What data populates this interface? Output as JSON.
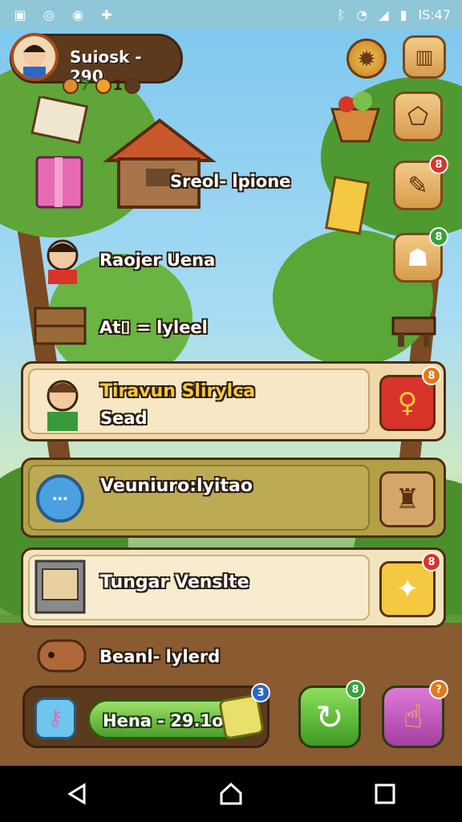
{
  "status_bar": {
    "time": "IS:47",
    "left_icons": [
      "app-icon",
      "circle-icon",
      "globe-icon",
      "puzzle-icon"
    ],
    "right_icons": [
      "bluetooth-icon",
      "wifi-icon",
      "signal-icon",
      "battery-icon"
    ]
  },
  "profile": {
    "name": "Suiosk - 290",
    "currency": [
      {
        "icon": "leaf-icon",
        "value": "7",
        "color": "#e38b2c"
      },
      {
        "icon": "coin-icon",
        "value": "1",
        "color": "#f0a22a"
      }
    ]
  },
  "top_buttons": {
    "settings": "gear-icon",
    "inventory": "box-icon"
  },
  "map_labels": {
    "house": "Sreol- lpione",
    "person": "Raojer Uena",
    "crate": "At⌷ = lyleel"
  },
  "side_buttons": [
    {
      "icon": "map-icon",
      "badge": ""
    },
    {
      "icon": "tool-icon",
      "badge": "8"
    },
    {
      "icon": "ghost-icon",
      "badge": "8"
    }
  ],
  "cards": [
    {
      "title": "Tiravun Slirylca",
      "sub": "Sead",
      "button_icon": "key-icon",
      "badge": "8",
      "theme": "cream"
    },
    {
      "title": "Veuniuro:lyitao",
      "sub": "",
      "button_icon": "stamp-icon",
      "badge": "",
      "theme": "olive"
    },
    {
      "title": "Tungar Venslte",
      "sub": "",
      "button_icon": "star-icon",
      "badge": "8",
      "theme": "light"
    }
  ],
  "ground_label": "Beanl- lylerd",
  "bottom_bar": {
    "value_text": "Hena - 29.1o",
    "badge": "3"
  },
  "big_buttons": [
    {
      "icon": "refresh-icon",
      "badge": "8"
    },
    {
      "icon": "thumbs-up-icon",
      "badge": "?"
    }
  ],
  "colors": {
    "wood": "#5b3a1e",
    "accent_green": "#4da02b",
    "badge_red": "#d8342a"
  }
}
